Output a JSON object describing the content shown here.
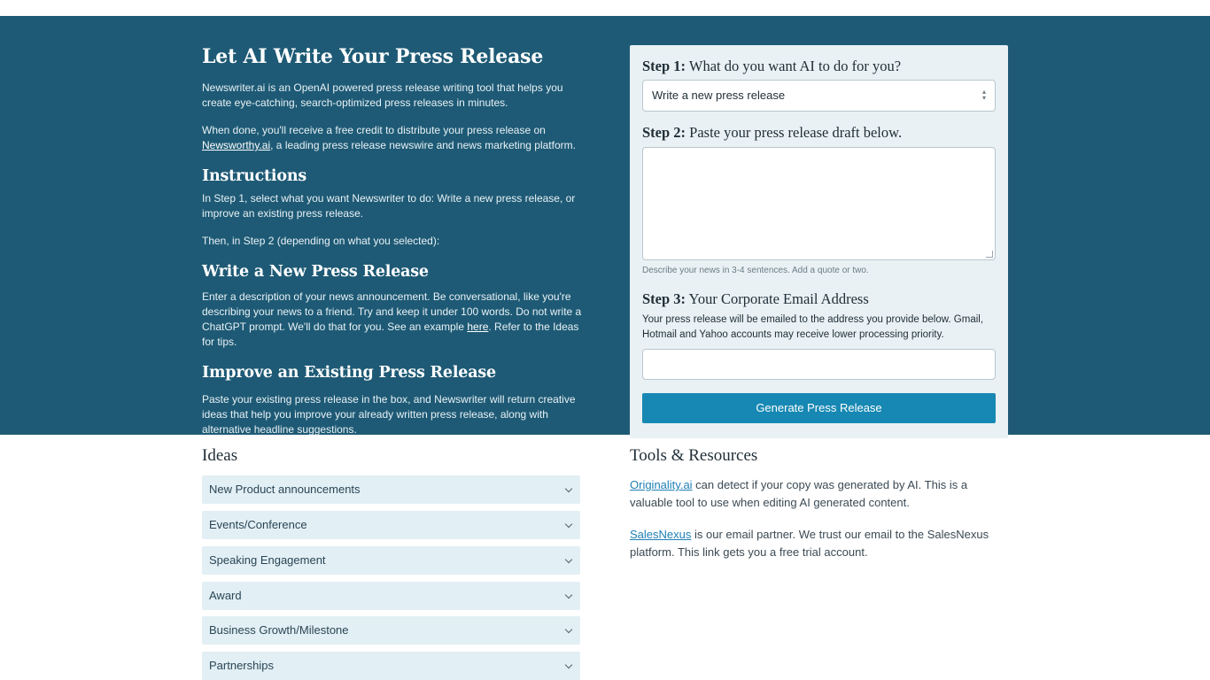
{
  "hero": {
    "title": "Let AI Write Your Press Release",
    "intro_p1": "Newswriter.ai is an OpenAI powered press release writing tool that helps you create eye-catching, search-optimized press releases in minutes.",
    "intro_p2_before": "When done, you'll receive a free credit to distribute your press release on ",
    "intro_p2_link": "Newsworthy.ai",
    "intro_p2_after": ", a leading press release newswire and news marketing platform.",
    "instructions_heading": "Instructions",
    "instructions_p1": "In Step 1, select what you want Newswriter to do: Write a new press release, or improve an existing press release.",
    "instructions_p2": "Then, in Step 2 (depending on what you selected):",
    "write_heading": "Write a New Press Release",
    "write_p_before": "Enter a description of your news announcement. Be conversational, like you're describing your news to a friend. Try and keep it under 100 words. Do not write a ChatGPT prompt. We'll do that for you. See an example ",
    "write_p_link": "here",
    "write_p_after": ". Refer to the Ideas for tips.",
    "improve_heading": "Improve an Existing Press Release",
    "improve_p": "Paste your existing press release in the box, and Newswriter will return creative ideas that help you improve your already written press release, along with alternative headline suggestions."
  },
  "form": {
    "step1_prefix": "Step 1:",
    "step1_text": " What do you want AI to do for you?",
    "step1_selected": "Write a new press release",
    "step2_prefix": "Step 2:",
    "step2_text": " Paste your press release draft below.",
    "step2_value": "",
    "step2_hint": "Describe your news in 3-4 sentences. Add a quote or two.",
    "step3_prefix": "Step 3:",
    "step3_text": " Your Corporate Email Address",
    "step3_note": "Your press release will be emailed to the address you provide below. Gmail, Hotmail and Yahoo accounts may receive lower processing priority.",
    "email_value": "",
    "generate_label": "Generate Press Release"
  },
  "ideas": {
    "title": "Ideas",
    "items": [
      "New Product announcements",
      "Events/Conference",
      "Speaking Engagement",
      "Award",
      "Business Growth/Milestone",
      "Partnerships"
    ]
  },
  "tools": {
    "title": "Tools & Resources",
    "p1_link": "Originality.ai",
    "p1_text": " can detect if your copy was generated by AI. This is a valuable tool to use when editing AI generated content.",
    "p2_link": "SalesNexus",
    "p2_text": " is our email partner. We trust our email to the SalesNexus platform. This link gets you a free trial account."
  },
  "colors": {
    "hero_bg": "#1e5a75",
    "card_bg": "#e9f1f4",
    "button_bg": "#1788b3",
    "accordion_bg": "#e2eff4",
    "link": "#1f80b5"
  }
}
